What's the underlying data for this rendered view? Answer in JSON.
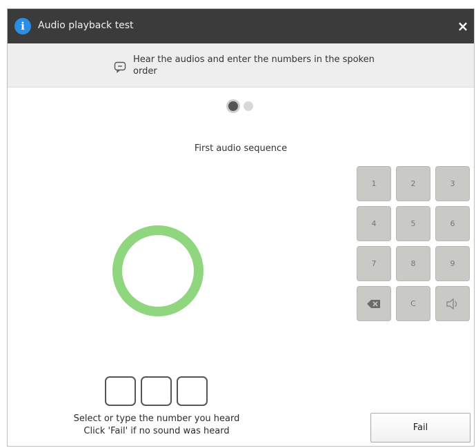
{
  "window": {
    "title": "Audio playback test",
    "close_label": "×"
  },
  "instruction": {
    "text": "Hear the audios and enter the numbers in the spoken order"
  },
  "pager": {
    "total": 2,
    "active_index": 0
  },
  "sequence_label": "First audio sequence",
  "keypad": {
    "keys": [
      "1",
      "2",
      "3",
      "4",
      "5",
      "6",
      "7",
      "8",
      "9",
      "",
      "C",
      ""
    ],
    "key_names": [
      "key-1",
      "key-2",
      "key-3",
      "key-4",
      "key-5",
      "key-6",
      "key-7",
      "key-8",
      "key-9",
      "key-backspace",
      "key-clear",
      "key-replay"
    ]
  },
  "answer": {
    "slots": 3
  },
  "help_text": {
    "line1": "Select or type the number you heard",
    "line2": "Click 'Fail' if no sound was heard"
  },
  "fail_button": {
    "label": "Fail"
  },
  "colors": {
    "titlebar": "#3b3b3b",
    "accent_ring": "#8fd67f",
    "info_icon": "#2a8ee6",
    "keypad_key": "#c9c9c5"
  },
  "icons": {
    "title": "info-icon",
    "instruction": "speech-bubble-icon",
    "backspace": "backspace-icon",
    "replay": "speaker-icon"
  }
}
